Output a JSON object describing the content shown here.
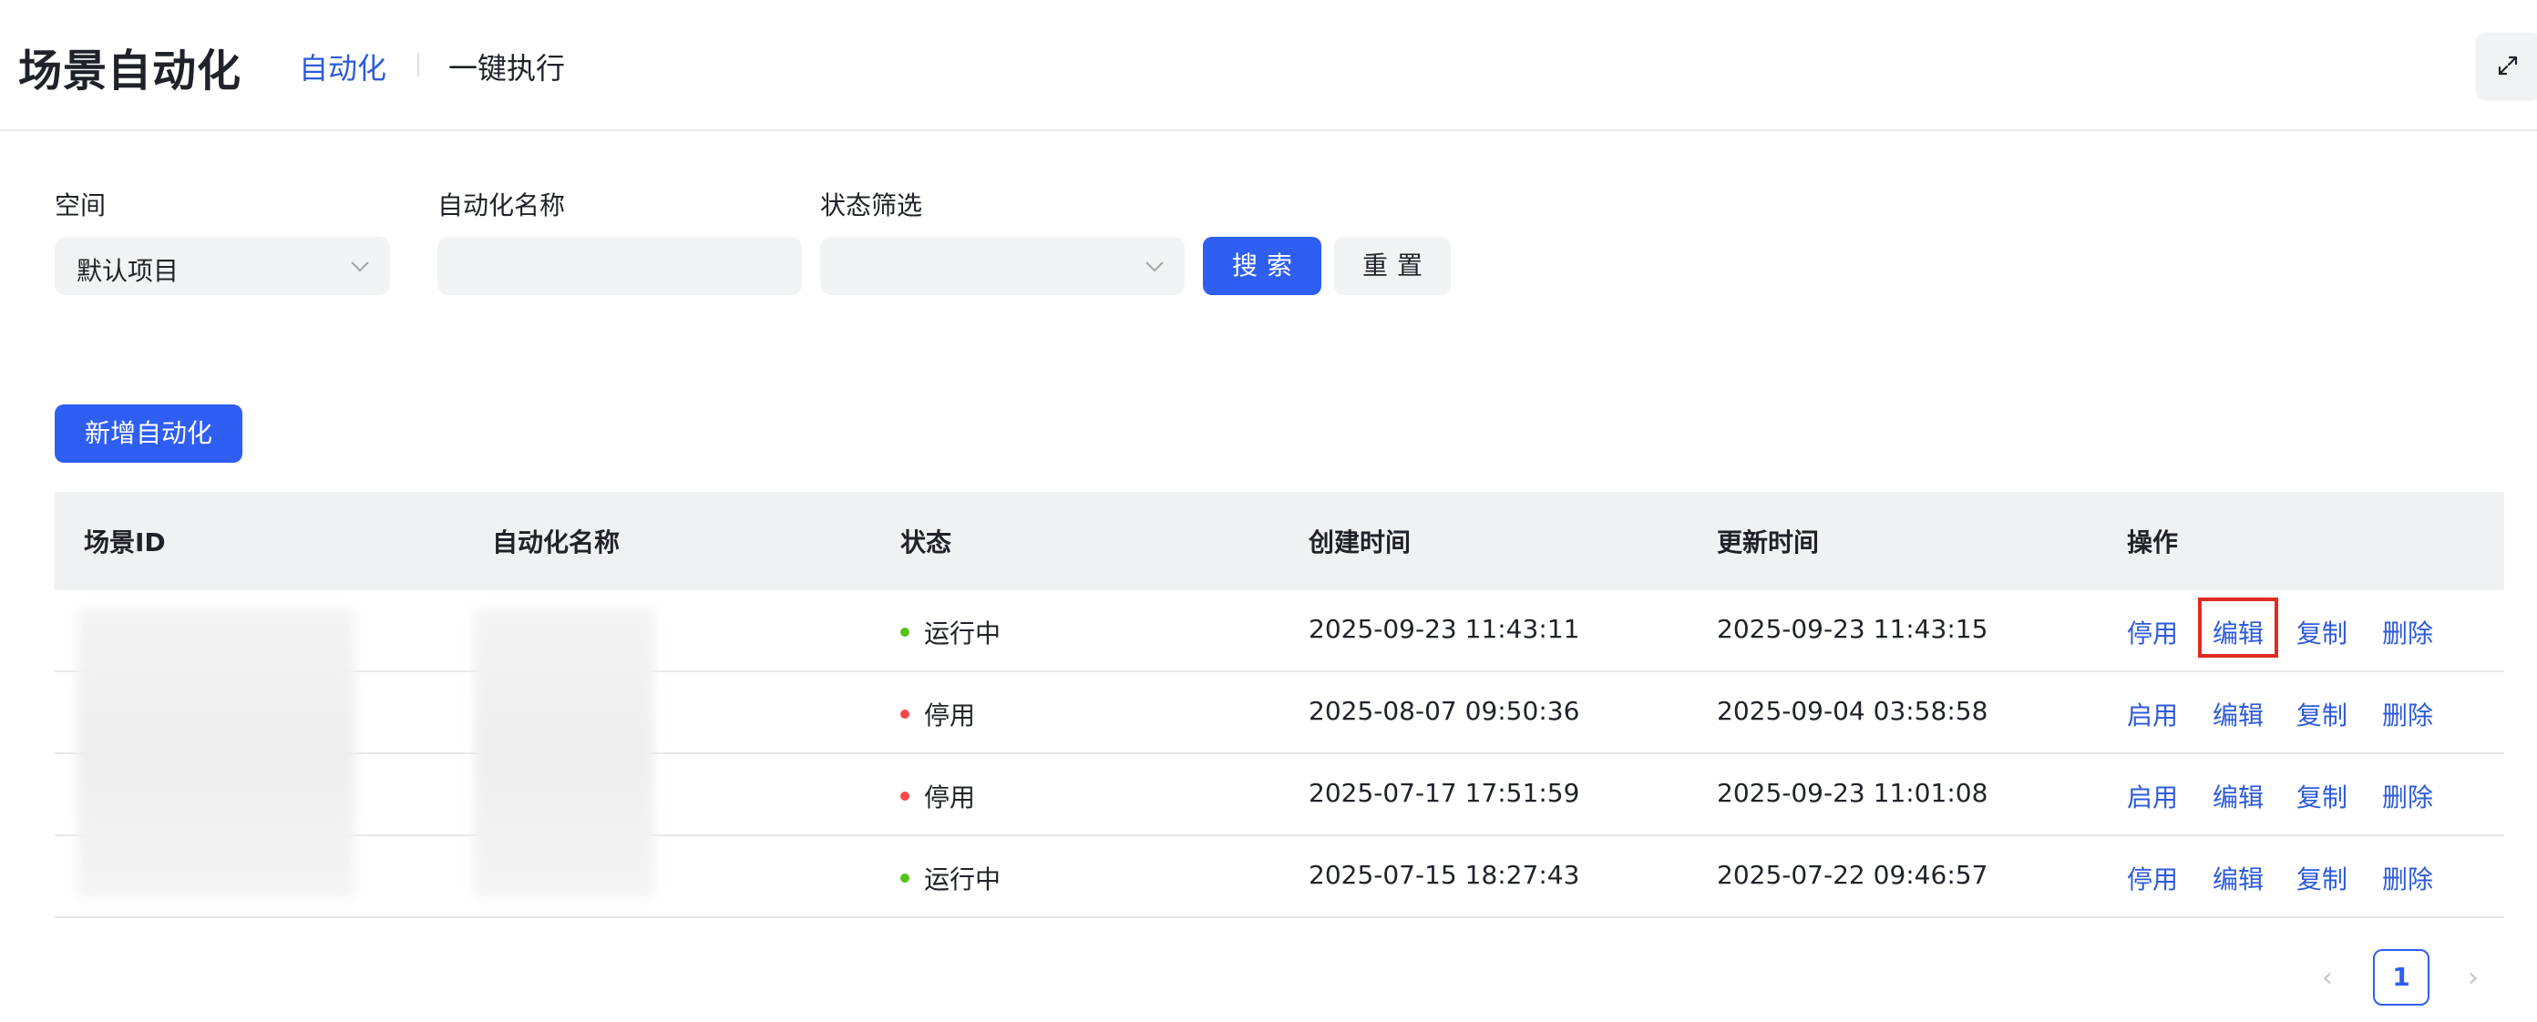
{
  "header": {
    "title": "场景自动化",
    "tabs": [
      {
        "label": "自动化",
        "active": true
      },
      {
        "label": "一键执行",
        "active": false
      }
    ],
    "expand_icon": "expand-icon"
  },
  "filters": {
    "space": {
      "label": "空间",
      "value": "默认项目"
    },
    "name": {
      "label": "自动化名称",
      "value": "",
      "placeholder": ""
    },
    "status": {
      "label": "状态筛选",
      "value": ""
    },
    "search_label": "搜索",
    "reset_label": "重置"
  },
  "actions": {
    "add_label": "新增自动化"
  },
  "table": {
    "columns": [
      "场景ID",
      "自动化名称",
      "状态",
      "创建时间",
      "更新时间",
      "操作"
    ],
    "rows": [
      {
        "status": "运行中",
        "created": "2025-09-23 11:43:11",
        "updated": "2025-09-23 11:43:15",
        "toggle": "停用",
        "edit": "编辑",
        "copy": "复制",
        "delete": "删除"
      },
      {
        "status": "停用",
        "created": "2025-08-07 09:50:36",
        "updated": "2025-09-04 03:58:58",
        "toggle": "启用",
        "edit": "编辑",
        "copy": "复制",
        "delete": "删除"
      },
      {
        "status": "停用",
        "created": "2025-07-17 17:51:59",
        "updated": "2025-09-23 11:01:08",
        "toggle": "启用",
        "edit": "编辑",
        "copy": "复制",
        "delete": "删除"
      },
      {
        "status": "运行中",
        "created": "2025-07-15 18:27:43",
        "updated": "2025-07-22 09:46:57",
        "toggle": "停用",
        "edit": "编辑",
        "copy": "复制",
        "delete": "删除"
      }
    ]
  },
  "colors": {
    "accent": "#2e5ef2",
    "link": "#2d5bd9",
    "running": "#52c41a",
    "stopped": "#f5484b",
    "highlight": "#e02b20"
  },
  "pagination": {
    "current_page": "1",
    "prev_icon": "chevron-left-icon",
    "next_icon": "chevron-right-icon"
  }
}
